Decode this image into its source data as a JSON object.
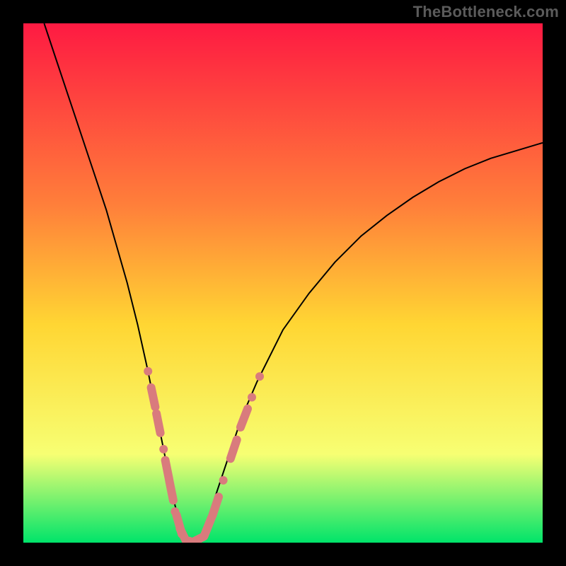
{
  "watermark": "TheBottleneck.com",
  "colors": {
    "page_bg": "#000000",
    "gradient_top": "#fe1a42",
    "gradient_mid1": "#ff7f3a",
    "gradient_mid2": "#ffd633",
    "gradient_mid3": "#f7ff73",
    "gradient_bottom": "#00e46a",
    "curve": "#000000",
    "marker_fill": "#d97b7d",
    "marker_stroke": "#d97b7d"
  },
  "chart_data": {
    "type": "line",
    "title": "",
    "xlabel": "",
    "ylabel": "",
    "xlim": [
      0,
      100
    ],
    "ylim": [
      0,
      100
    ],
    "grid": false,
    "legend": false,
    "series": [
      {
        "name": "bottleneck-curve",
        "x": [
          4,
          6,
          8,
          10,
          12,
          14,
          16,
          18,
          20,
          22,
          24,
          26,
          27,
          28,
          29,
          30,
          31,
          32,
          33,
          34,
          35,
          36,
          38,
          40,
          42,
          45,
          50,
          55,
          60,
          65,
          70,
          75,
          80,
          85,
          90,
          95,
          100
        ],
        "y": [
          100,
          94,
          88,
          82,
          76,
          70,
          64,
          57,
          50,
          42,
          33,
          23,
          18,
          13,
          8,
          4,
          1,
          0,
          0,
          1,
          3,
          6,
          12,
          18,
          24,
          31,
          41,
          48,
          54,
          59,
          63,
          66.5,
          69.5,
          72,
          74,
          75.5,
          77
        ]
      }
    ],
    "markers": [
      {
        "x": 24.0,
        "y": 33,
        "kind": "dot"
      },
      {
        "x": 25.0,
        "y": 28,
        "kind": "pill"
      },
      {
        "x": 26.0,
        "y": 23,
        "kind": "pill"
      },
      {
        "x": 27.0,
        "y": 18,
        "kind": "dot"
      },
      {
        "x": 27.7,
        "y": 14,
        "kind": "pill"
      },
      {
        "x": 28.5,
        "y": 10,
        "kind": "pill"
      },
      {
        "x": 29.2,
        "y": 6,
        "kind": "dot"
      },
      {
        "x": 30.0,
        "y": 3.5,
        "kind": "pill"
      },
      {
        "x": 31.0,
        "y": 1.0,
        "kind": "pill"
      },
      {
        "x": 32.0,
        "y": 0.3,
        "kind": "dot"
      },
      {
        "x": 33.0,
        "y": 0.3,
        "kind": "pill"
      },
      {
        "x": 34.0,
        "y": 0.8,
        "kind": "dot"
      },
      {
        "x": 35.5,
        "y": 3.0,
        "kind": "pill"
      },
      {
        "x": 37.0,
        "y": 7.0,
        "kind": "pill"
      },
      {
        "x": 38.5,
        "y": 12,
        "kind": "dot"
      },
      {
        "x": 40.5,
        "y": 18,
        "kind": "pill"
      },
      {
        "x": 42.5,
        "y": 24,
        "kind": "pill"
      },
      {
        "x": 44.0,
        "y": 28,
        "kind": "dot"
      },
      {
        "x": 45.5,
        "y": 32,
        "kind": "dot"
      }
    ]
  }
}
